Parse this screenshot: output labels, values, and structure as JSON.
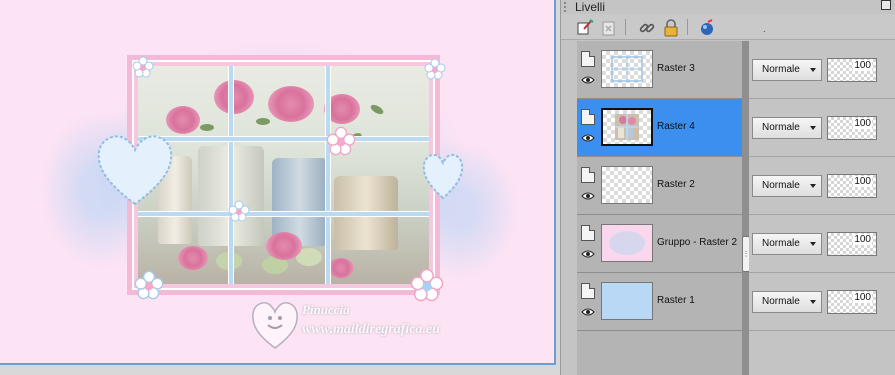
{
  "canvas": {
    "watermark": {
      "name": "Pinuccia",
      "url": "www.maildiregrafica.eu"
    }
  },
  "panel": {
    "title": "Livelli",
    "toolbar": {
      "buttons": [
        "new-layer-icon",
        "delete-layer-icon",
        "link-icon",
        "lock-icon",
        "blend-ball-icon"
      ],
      "trailing_mark": "."
    },
    "layers": [
      {
        "name": "Raster 3",
        "blend_mode": "Normale",
        "opacity": "100",
        "selected": false,
        "thumb": "frame-outline"
      },
      {
        "name": "Raster 4",
        "blend_mode": "Normale",
        "opacity": "100",
        "selected": true,
        "thumb": "picture"
      },
      {
        "name": "Raster 2",
        "blend_mode": "Normale",
        "opacity": "100",
        "selected": false,
        "thumb": "transparent"
      },
      {
        "name": "Gruppo - Raster 2",
        "blend_mode": "Normale",
        "opacity": "100",
        "selected": false,
        "thumb": "pink"
      },
      {
        "name": "Raster 1",
        "blend_mode": "Normale",
        "opacity": "100",
        "selected": false,
        "thumb": "blue"
      }
    ],
    "scroll_grip": "⋮"
  },
  "colors": {
    "selection": "#3a8fef",
    "canvas_bg": "#fde4f4",
    "raster1_fill": "#b9d8f6",
    "group_fill": "#fad7ec"
  }
}
